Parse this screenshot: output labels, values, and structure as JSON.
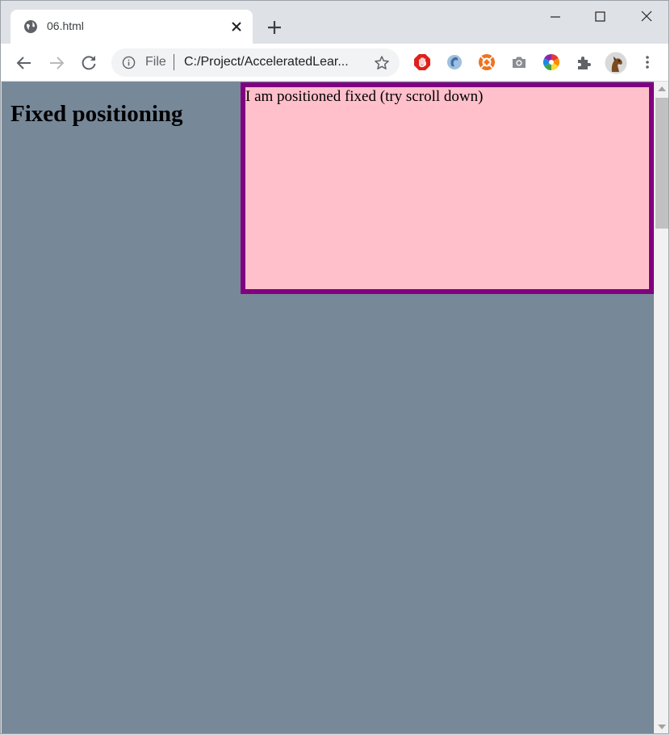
{
  "browser": {
    "tab": {
      "title": "06.html"
    },
    "address": {
      "scheme_label": "File",
      "url": "C:/Project/AcceleratedLear..."
    }
  },
  "page": {
    "heading": "Fixed positioning",
    "fixed_box_text": "I am positioned fixed (try scroll down)",
    "background_color": "#778899",
    "box_background_color": "#ffc0cb",
    "box_border_color": "#800080"
  },
  "icons": {
    "tab_favicon": "globe-icon",
    "tab_close": "close-icon",
    "new_tab": "plus-icon",
    "minimize": "minimize-icon",
    "maximize": "maximize-icon",
    "window_close": "close-icon",
    "back": "back-arrow-icon",
    "forward": "forward-arrow-icon",
    "reload": "reload-icon",
    "site_info": "info-icon",
    "bookmark": "star-icon",
    "extensions": [
      "adblock-icon",
      "extension-swirl-icon",
      "extension-orange-icon",
      "camera-icon",
      "color-wheel-icon",
      "puzzle-icon"
    ],
    "profile": "avatar-horse-icon",
    "menu": "more-vert-icon"
  }
}
